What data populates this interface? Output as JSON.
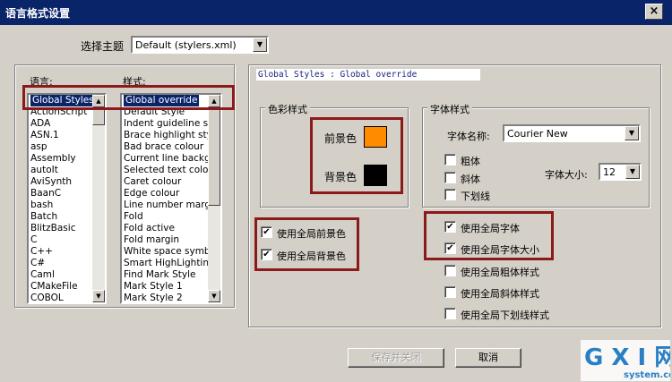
{
  "window": {
    "title": "语言格式设置",
    "close_glyph": "×"
  },
  "theme": {
    "label": "选择主题",
    "value": "Default (stylers.xml)"
  },
  "language_label": "语言:",
  "style_label": "样式:",
  "languages": [
    "Global Styles",
    "ActionScript",
    "ADA",
    "ASN.1",
    "asp",
    "Assembly",
    "autoIt",
    "AviSynth",
    "BaanC",
    "bash",
    "Batch",
    "BlitzBasic",
    "C",
    "C++",
    "C#",
    "Caml",
    "CMakeFile",
    "COBOL"
  ],
  "selected_language": "Global Styles",
  "styles": [
    "Global override",
    "Default Style",
    "Indent guideline sty",
    "Brace highlight style",
    "Bad brace colour",
    "Current line backgro",
    "Selected text colour",
    "Caret colour",
    "Edge colour",
    "Line number margin",
    "Fold",
    "Fold active",
    "Fold margin",
    "White space symbo",
    "Smart HighLighting",
    "Find Mark Style",
    "Mark Style 1",
    "Mark Style 2"
  ],
  "selected_style": "Global override",
  "preview_text": "Global Styles : Global override",
  "color_group": {
    "title": "色彩样式",
    "fg_label": "前景色",
    "bg_label": "背景色",
    "fg_color": "#ff8c00",
    "bg_color": "#000000"
  },
  "font_group": {
    "title": "字体样式",
    "name_label": "字体名称:",
    "name_value": "Courier New",
    "size_label": "字体大小:",
    "size_value": "12",
    "bold_label": "粗体",
    "italic_label": "斜体",
    "underline_label": "下划线"
  },
  "global_checks": {
    "use_global_fg": "使用全局前景色",
    "use_global_bg": "使用全局背景色",
    "use_global_font": "使用全局字体",
    "use_global_font_size": "使用全局字体大小",
    "use_global_bold": "使用全局粗体样式",
    "use_global_italic": "使用全局斜体样式",
    "use_global_underline": "使用全局下划线样式"
  },
  "check_glyph": "✔",
  "buttons": {
    "save_close": "保存并关闭",
    "cancel": "取消"
  },
  "watermark": {
    "logo": "G X I 网",
    "site": "system.com"
  }
}
